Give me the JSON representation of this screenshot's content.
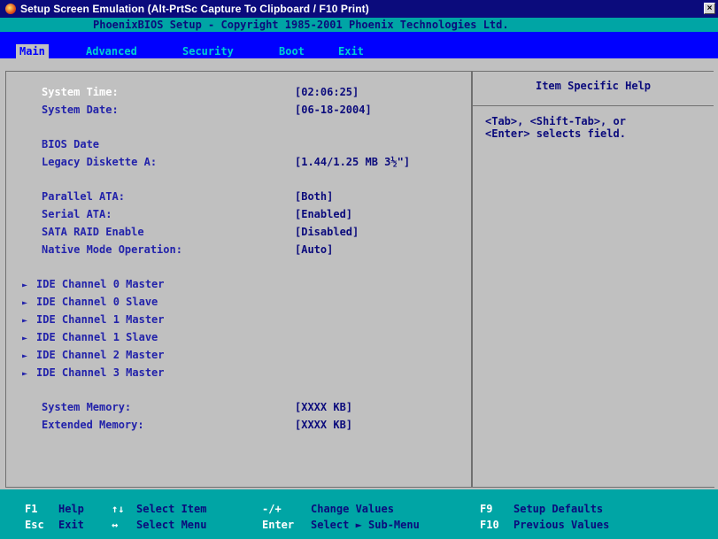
{
  "window": {
    "title": "Setup Screen Emulation (Alt-PrtSc Capture To Clipboard / F10 Print)",
    "close_glyph": "×"
  },
  "copyright": "PhoenixBIOS Setup - Copyright 1985-2001 Phoenix Technologies Ltd.",
  "menu": {
    "items": [
      "Main",
      "Advanced",
      "Security",
      "Boot",
      "Exit"
    ],
    "active": "Main"
  },
  "fields": {
    "system_time": {
      "label": "System Time:",
      "value": "[02:06:25]"
    },
    "system_date": {
      "label": "System Date:",
      "value": "[06-18-2004]"
    },
    "bios_date": {
      "label": "BIOS Date"
    },
    "legacy_diskette": {
      "label": "Legacy Diskette A:",
      "value": "[1.44/1.25 MB  3½\"]"
    },
    "parallel_ata": {
      "label": "Parallel ATA:",
      "value": "[Both]"
    },
    "serial_ata": {
      "label": "Serial ATA:",
      "value": "[Enabled]"
    },
    "sata_raid": {
      "label": "SATA RAID Enable",
      "value": "[Disabled]"
    },
    "native_mode": {
      "label": "Native Mode Operation:",
      "value": "[Auto]"
    },
    "system_memory": {
      "label": "System Memory:",
      "value": "[XXXX KB]"
    },
    "extended_memory": {
      "label": "Extended Memory:",
      "value": "[XXXX KB]"
    }
  },
  "submenus": [
    "IDE Channel 0 Master",
    "IDE Channel 0 Slave",
    "IDE Channel 1 Master",
    "IDE Channel 1 Slave",
    "IDE Channel 2 Master",
    "IDE Channel 3 Master"
  ],
  "help": {
    "title": "Item Specific Help",
    "text": "<Tab>, <Shift-Tab>, or\n<Enter> selects field."
  },
  "footer": {
    "f1_key": "F1",
    "f1_desc": "Help",
    "updown_key": "↑↓",
    "updown_desc": "Select Item",
    "plusminus_key": "-/+",
    "plusminus_desc": "Change Values",
    "f9_key": "F9",
    "f9_desc": "Setup Defaults",
    "esc_key": "Esc",
    "esc_desc": "Exit",
    "leftright_key": "↔",
    "leftright_desc": "Select Menu",
    "enter_key": "Enter",
    "enter_desc": "Select ► Sub-Menu",
    "f10_key": "F10",
    "f10_desc": "Previous Values"
  },
  "icons": {
    "app": "setup-app-icon",
    "submenu": "triangle-right-icon"
  },
  "colors": {
    "title_bar": "#0b0b7c",
    "menu_bar": "#0000ff",
    "status_bars": "#00a5a5",
    "panel_bg": "#c0c0c0",
    "label_text": "#2222aa",
    "highlight_text": "#ffffff"
  }
}
